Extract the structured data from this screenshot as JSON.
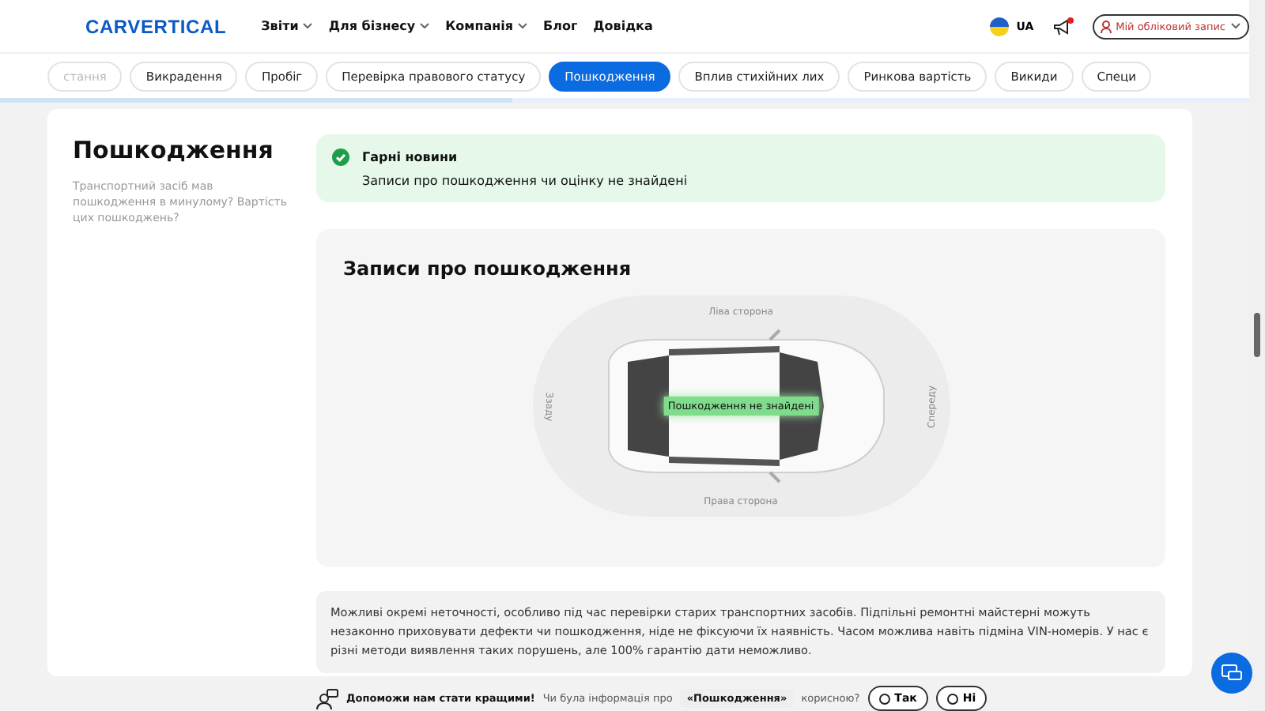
{
  "header": {
    "logo": "CARVERTICAL",
    "nav": [
      {
        "label": "Звіти",
        "dropdown": true
      },
      {
        "label": "Для бізнесу",
        "dropdown": true
      },
      {
        "label": "Компанія",
        "dropdown": true
      },
      {
        "label": "Блог",
        "dropdown": false
      },
      {
        "label": "Довідка",
        "dropdown": false
      }
    ],
    "language": "UA",
    "notification_unread": true,
    "account": "Мій обліковий запис"
  },
  "tabs": [
    {
      "label": "стання",
      "selected": false
    },
    {
      "label": "Викрадення",
      "selected": false
    },
    {
      "label": "Пробіг",
      "selected": false
    },
    {
      "label": "Перевірка правового статусу",
      "selected": false
    },
    {
      "label": "Пошкодження",
      "selected": true
    },
    {
      "label": "Вплив стихійних лих",
      "selected": false
    },
    {
      "label": "Ринкова вартість",
      "selected": false
    },
    {
      "label": "Викиди",
      "selected": false
    },
    {
      "label": "Специ",
      "selected": false
    }
  ],
  "progress": {
    "level": 0.41
  },
  "section": {
    "title": "Пошкодження",
    "description": "Транспортний засіб мав пошкодження в минулому? Вартість цих пошкоджень?"
  },
  "alert": {
    "title": "Гарні новини",
    "message": "Записи про пошкодження чи оцінку не знайдені"
  },
  "records": {
    "title": "Записи про пошкодження",
    "left": "Ліва сторона",
    "right": "Права сторона",
    "rear": "Ззаду",
    "front": "Спереду",
    "badge": "Пошкодження не знайдені"
  },
  "note": "Можливі окремі неточності, особливо під час перевірки старих транспортних засобів. Підпільні ремонтні майстерні можуть незаконно приховувати дефекти чи пошкодження, ніде не фіксуючи їх наявність. Часом можлива навіть підміна VIN-номерів. У нас є різні методи виявлення таких порушень, але 100% гарантію дати неможливо.",
  "feedback": {
    "title": "Допоможи нам стати кращими!",
    "question_before": "Чи була інформація про",
    "topic": "«Пошкодження»",
    "question_after": "корисною?",
    "buttons": [
      "Так",
      "Ні"
    ]
  }
}
